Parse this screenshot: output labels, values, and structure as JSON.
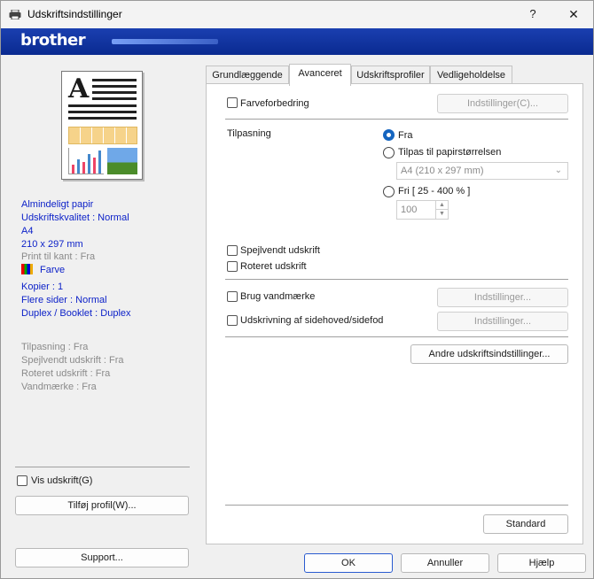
{
  "window": {
    "title": "Udskriftsindstillinger",
    "help_label": "?",
    "close_label": "✕",
    "brand": "brother"
  },
  "left": {
    "info_blue": [
      "Almindeligt papir",
      "Udskriftskvalitet : Normal",
      "A4",
      "210 x 297 mm"
    ],
    "print_to_edge": "Print til kant : Fra",
    "color_label": "Farve",
    "info_blue2": [
      "Kopier : 1",
      "Flere sider : Normal",
      "Duplex / Booklet : Duplex"
    ],
    "info_grey": [
      "Tilpasning : Fra",
      "Spejlvendt udskrift : Fra",
      "Roteret udskrift : Fra",
      "Vandmærke : Fra"
    ],
    "show_print_label": "Vis udskrift(G)",
    "add_profile_label": "Tilføj profil(W)...",
    "support_label": "Support..."
  },
  "tabs": [
    "Grundlæggende",
    "Avanceret",
    "Udskriftsprofiler",
    "Vedligeholdelse"
  ],
  "advanced": {
    "color_enhance_label": "Farveforbedring",
    "settings_c_label": "Indstillinger(C)...",
    "scaling_label": "Tilpasning",
    "radio_off_label": "Fra",
    "radio_fit_label": "Tilpas til papirstørrelsen",
    "paper_select_value": "A4 (210 x 297 mm)",
    "radio_free_label": "Fri [ 25 - 400 % ]",
    "free_value": "100",
    "mirror_label": "Spejlvendt udskrift",
    "rotate_label": "Roteret udskrift",
    "watermark_label": "Brug vandmærke",
    "watermark_settings_label": "Indstillinger...",
    "header_footer_label": "Udskrivning af sidehoved/sidefod",
    "header_settings_label": "Indstillinger...",
    "other_settings_label": "Andre udskriftsindstillinger...",
    "standard_label": "Standard"
  },
  "footer": {
    "ok_label": "OK",
    "cancel_label": "Annuller",
    "help_label": "Hjælp"
  }
}
